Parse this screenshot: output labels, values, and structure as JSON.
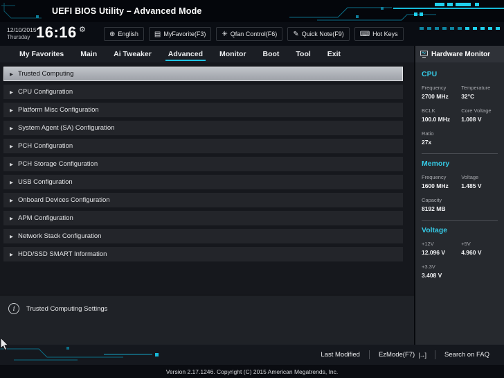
{
  "titlebar": {
    "title": "UEFI BIOS Utility – Advanced Mode"
  },
  "clock": {
    "date": "12/10/2015",
    "day": "Thursday",
    "time": "16:16",
    "gear_icon": "⚙"
  },
  "toolbar": {
    "items": [
      {
        "name": "language",
        "icon_name": "globe-icon",
        "icon": "⊕",
        "label": "English"
      },
      {
        "name": "my-favorite",
        "icon_name": "favorite-icon",
        "icon": "▤",
        "label": "MyFavorite(F3)"
      },
      {
        "name": "qfan-control",
        "icon_name": "fan-icon",
        "icon": "✳",
        "label": "Qfan Control(F6)"
      },
      {
        "name": "quick-note",
        "icon_name": "note-icon",
        "icon": "✎",
        "label": "Quick Note(F9)"
      },
      {
        "name": "hot-keys",
        "icon_name": "keyboard-icon",
        "icon": "⌨",
        "label": "Hot Keys"
      }
    ]
  },
  "menu": {
    "tabs": [
      {
        "label": "My Favorites",
        "active": false
      },
      {
        "label": "Main",
        "active": false
      },
      {
        "label": "Ai Tweaker",
        "active": false
      },
      {
        "label": "Advanced",
        "active": true
      },
      {
        "label": "Monitor",
        "active": false
      },
      {
        "label": "Boot",
        "active": false
      },
      {
        "label": "Tool",
        "active": false
      },
      {
        "label": "Exit",
        "active": false
      }
    ]
  },
  "list": {
    "selected_index": 0,
    "arrow_icon": "▶",
    "items": [
      "Trusted Computing",
      "CPU Configuration",
      "Platform Misc Configuration",
      "System Agent (SA) Configuration",
      "PCH Configuration",
      "PCH Storage Configuration",
      "USB Configuration",
      "Onboard Devices Configuration",
      "APM Configuration",
      "Network Stack Configuration",
      "HDD/SSD SMART Information"
    ]
  },
  "info_panel": {
    "icon": "i",
    "text": "Trusted Computing Settings"
  },
  "hardware_monitor": {
    "title": "Hardware Monitor",
    "sections": [
      {
        "title": "CPU",
        "rows": [
          [
            {
              "label": "Frequency",
              "value": "2700 MHz"
            },
            {
              "label": "Temperature",
              "value": "32°C"
            }
          ],
          [
            {
              "label": "BCLK",
              "value": "100.0 MHz"
            },
            {
              "label": "Core Voltage",
              "value": "1.008 V"
            }
          ],
          [
            {
              "label": "Ratio",
              "value": "27x"
            }
          ]
        ]
      },
      {
        "title": "Memory",
        "rows": [
          [
            {
              "label": "Frequency",
              "value": "1600 MHz"
            },
            {
              "label": "Voltage",
              "value": "1.485 V"
            }
          ],
          [
            {
              "label": "Capacity",
              "value": "8192 MB"
            }
          ]
        ]
      },
      {
        "title": "Voltage",
        "rows": [
          [
            {
              "label": "+12V",
              "value": "12.096 V"
            },
            {
              "label": "+5V",
              "value": "4.960 V"
            }
          ],
          [
            {
              "label": "+3.3V",
              "value": "3.408 V"
            }
          ]
        ]
      }
    ]
  },
  "footer": {
    "items": [
      {
        "name": "last-modified",
        "label": "Last Modified",
        "icon": ""
      },
      {
        "name": "ez-mode",
        "label": "EzMode(F7)",
        "icon": "|→]"
      },
      {
        "name": "search-on-faq",
        "label": "Search on FAQ",
        "icon": ""
      }
    ],
    "version": "Version 2.17.1246. Copyright (C) 2015 American Megatrends, Inc."
  },
  "colors": {
    "accent": "#1fc3e2",
    "accent_dim": "#0c6e87",
    "selected_row": "#aab0b7"
  }
}
